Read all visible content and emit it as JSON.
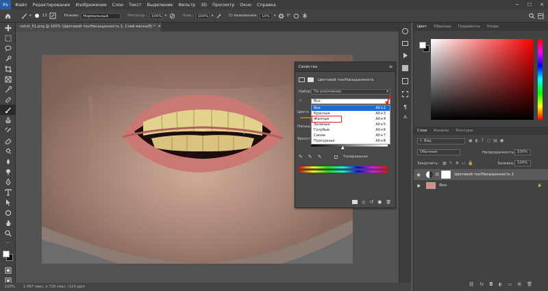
{
  "menu": [
    "Файл",
    "Редактирование",
    "Изображение",
    "Слои",
    "Текст",
    "Выделение",
    "Фильтр",
    "3D",
    "Просмотр",
    "Окно",
    "Справка"
  ],
  "options": {
    "mode_label": "Режим:",
    "mode_value": "Нормальный",
    "opacity_label": "Непрозр.:",
    "opacity_value": "100%",
    "pressure_label": "Наж.:",
    "pressure_value": "100%",
    "smoothing_label": "Сглаживание:",
    "smoothing_value": "10%",
    "brush_size": "13"
  },
  "doc_tab": "nshot_51.png @ 100% (Цветовой тон/Насыщенность 1, Слой-маска/8) *",
  "status": {
    "zoom": "100%",
    "size": "1 097 пикс. x 729 пикс. (120 ppi)"
  },
  "properties": {
    "title": "Свойства",
    "adjustment": "Цветовой тон/Насыщенность",
    "preset_label": "Набор:",
    "preset_value": "По умолчанию",
    "channel_value": "Все",
    "hue_label": "Цвето",
    "sat_label": "Насыщ",
    "light_label": "Яркост",
    "colorize": "Тонирование",
    "channels": [
      {
        "name": "Все",
        "key": "Alt+2"
      },
      {
        "name": "Красные",
        "key": "Alt+3"
      },
      {
        "name": "Желтые",
        "key": "Alt+4"
      },
      {
        "name": "Зеленые",
        "key": "Alt+5"
      },
      {
        "name": "Голубые",
        "key": "Alt+6"
      },
      {
        "name": "Синие",
        "key": "Alt+7"
      },
      {
        "name": "Пурпурные",
        "key": "Alt+8"
      }
    ]
  },
  "color_panel": {
    "tabs": [
      "Цвет",
      "Образцы",
      "Градиенты",
      "Узоры"
    ]
  },
  "layers_panel": {
    "tabs": [
      "Слои",
      "Каналы",
      "Контуры"
    ],
    "kind": "Вид",
    "blend": "Обычные",
    "opacity_label": "Непрозрачность:",
    "opacity_value": "100%",
    "lock_label": "Закрепить:",
    "fill_label": "Заливка:",
    "fill_value": "100%",
    "layers": [
      {
        "name": "Цветовой тон/Насыщенность 1"
      },
      {
        "name": "Фон"
      }
    ]
  },
  "colors": {
    "accent": "#1a6ae0",
    "highlight": "#e02020"
  }
}
